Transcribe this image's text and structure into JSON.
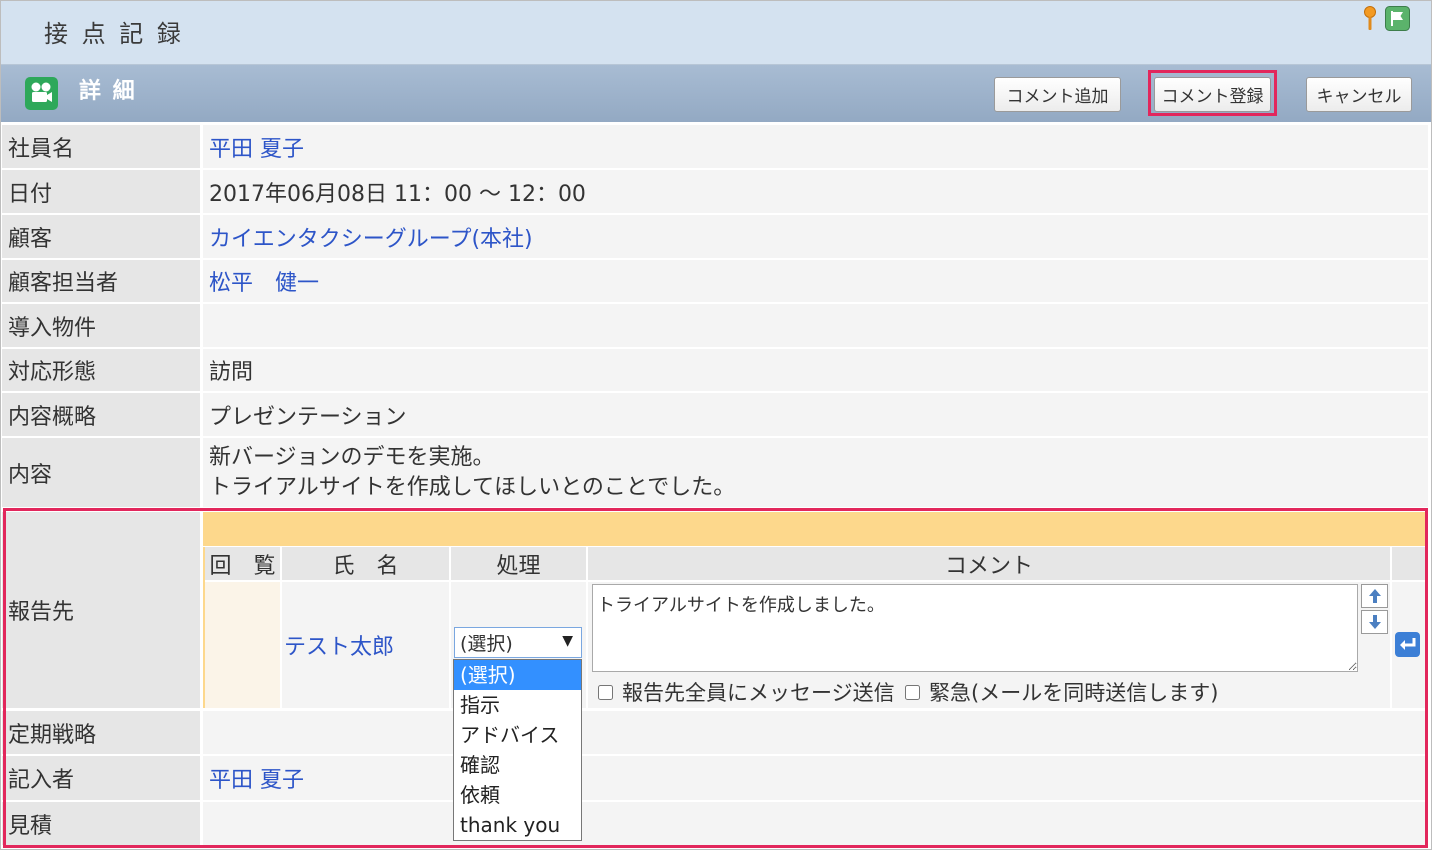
{
  "header": {
    "title": "接 点 記 録",
    "pin_icon": "pin-icon",
    "flag_icon": "flag-icon"
  },
  "detail_bar": {
    "icon": "camera-icon",
    "title": "詳 細",
    "add_comment_label": "コメント追加",
    "register_comment_label": "コメント登録",
    "cancel_label": "キャンセル"
  },
  "fields": [
    {
      "label": "社員名",
      "value": "平田 夏子"
    },
    {
      "label": "日付",
      "value": "2017年06月08日 11：00 ～ 12：00"
    },
    {
      "label": "顧客",
      "value": "カイエンタクシーグループ(本社)"
    },
    {
      "label": "顧客担当者",
      "value": "松平　健一"
    },
    {
      "label": "導入物件",
      "value": ""
    },
    {
      "label": "対応形態",
      "value": "訪問"
    },
    {
      "label": "内容概略",
      "value": "プレゼンテーション"
    },
    {
      "label": "内容",
      "value_lines": [
        "新バージョンのデモを実施。",
        "トライアルサイトを作成してほしいとのことでした。"
      ]
    }
  ],
  "report": {
    "label": "報告先",
    "columns": {
      "view": "回　覧",
      "name": "氏　名",
      "action": "処理",
      "comment": "コメント"
    },
    "row": {
      "view": "",
      "name": "テスト太郎",
      "action_selected": "(選択)",
      "action_options": [
        "(選択)",
        "指示",
        "アドバイス",
        "確認",
        "依頼",
        "thank you"
      ],
      "action_highlighted_index": 0,
      "comment": "トライアルサイトを作成しました。",
      "move_up_icon": "arrow-up-icon",
      "move_down_icon": "arrow-down-icon",
      "return_icon": "return-icon"
    },
    "send_all": {
      "label": "報告先全員にメッセージ送信",
      "checked": false
    },
    "urgent": {
      "label": "緊急(メールを同時送信します)",
      "checked": false
    }
  },
  "fields_after": [
    {
      "label": "定期戦略",
      "value": ""
    },
    {
      "label": "記入者",
      "value": "平田 夏子"
    },
    {
      "label": "見積",
      "value": ""
    }
  ],
  "colors": {
    "header_bg": "#d4e2f0",
    "detail_bar_bg": "#9cb1c9",
    "label_bg": "#e6e6e6",
    "value_bg": "#f4f4f4",
    "link": "#2d55c8",
    "report_bar": "#fdd88c",
    "option_highlight": "#3390ff",
    "highlight_box": "#e2275c"
  }
}
